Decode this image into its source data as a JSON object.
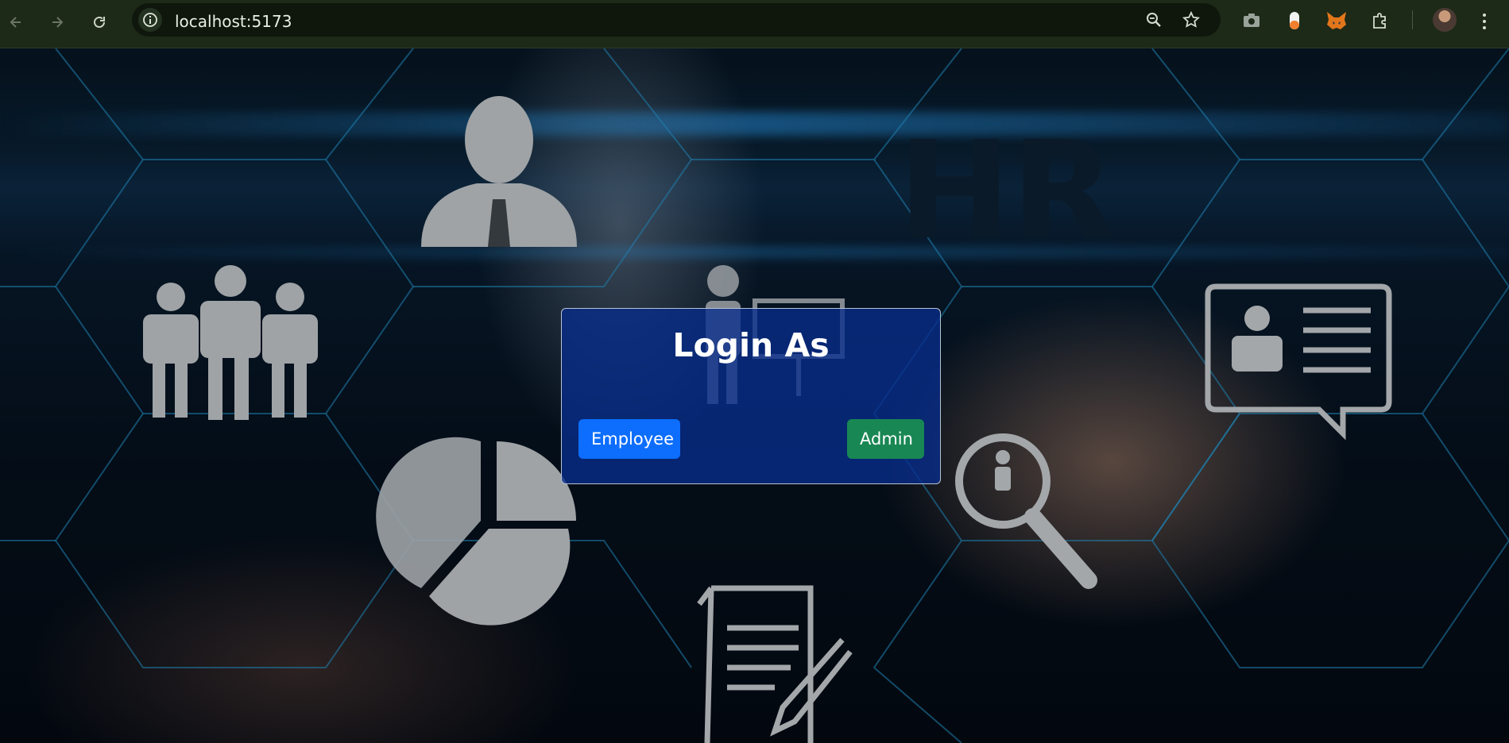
{
  "browser": {
    "url": "localhost:5173",
    "icons": {
      "back": "back-arrow-icon",
      "forward": "forward-arrow-icon",
      "reload": "reload-icon",
      "site_info": "info-icon",
      "zoom": "zoom-icon",
      "bookmark": "star-icon",
      "screenshot_ext": "camera-icon",
      "ext_2": "capsule-icon",
      "metamask_ext": "fox-icon",
      "extensions": "puzzle-icon",
      "profile": "avatar",
      "menu": "more-vert-icon"
    }
  },
  "login": {
    "title": "Login As",
    "employee_label": "Employee",
    "admin_label": "Admin"
  },
  "colors": {
    "chrome_bg": "#1d2a18",
    "card_bg": "#082d8c",
    "employee_btn": "#0d6efd",
    "admin_btn": "#198754"
  },
  "background": {
    "banner_text": "HR"
  }
}
